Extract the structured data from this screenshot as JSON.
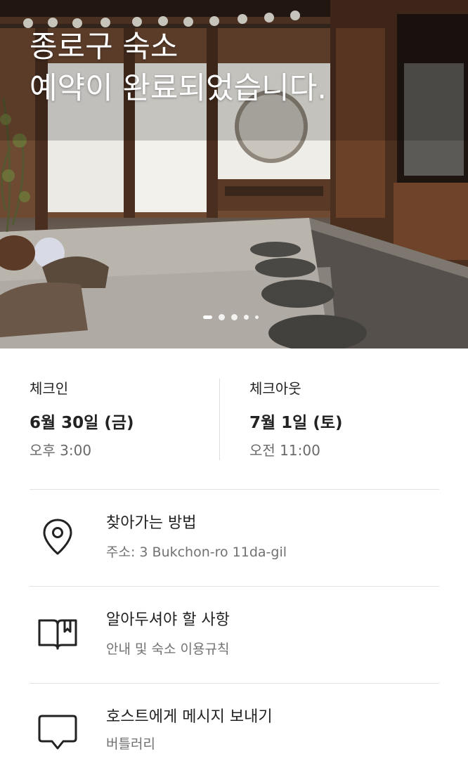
{
  "hero": {
    "title_line1": "종로구 숙소",
    "title_line2": "예약이 완료되었습니다.",
    "pagination": {
      "count": 5,
      "active_index": 0
    }
  },
  "checkin": {
    "label": "체크인",
    "date": "6월 30일 (금)",
    "time": "오후 3:00"
  },
  "checkout": {
    "label": "체크아웃",
    "date": "7월 1일 (토)",
    "time": "오전 11:00"
  },
  "rows": [
    {
      "icon": "map-pin-icon",
      "title": "찾아가는 방법",
      "subtitle": "주소: 3 Bukchon-ro 11da-gil"
    },
    {
      "icon": "book-icon",
      "title": "알아두셔야 할 사항",
      "subtitle": "안내 및 숙소 이용규칙"
    },
    {
      "icon": "message-icon",
      "title": "호스트에게 메시지 보내기",
      "subtitle": "버틀러리"
    }
  ],
  "colors": {
    "primary_text": "#222222",
    "secondary_text": "#717171",
    "divider": "#e2e2e2"
  }
}
